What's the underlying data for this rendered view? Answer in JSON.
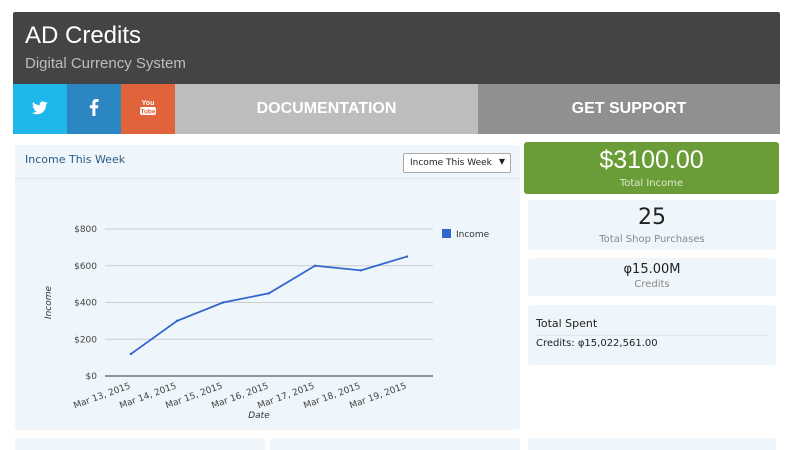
{
  "header": {
    "title": "AD Credits",
    "subtitle": "Digital Currency System"
  },
  "nav": {
    "documentation": "DOCUMENTATION",
    "support": "GET SUPPORT"
  },
  "panel": {
    "title": "Income This Week",
    "select_value": "Income This Week"
  },
  "summary": {
    "total_income_value": "$3100.00",
    "total_income_label": "Total Income",
    "shop_purchases_value": "25",
    "shop_purchases_label": "Total Shop Purchases",
    "credits_value": "φ15.00M",
    "credits_label": "Credits",
    "total_spent_title": "Total Spent",
    "total_spent_value": "Credits: φ15,022,561.00"
  },
  "colors": {
    "header_bg": "#444444",
    "twitter": "#1fb6ea",
    "facebook": "#2c86c2",
    "youtube": "#e0633c",
    "total_income_card": "#6a9c37",
    "series_line": "#3366cc"
  },
  "icons": [
    "twitter-icon",
    "facebook-icon",
    "youtube-icon"
  ],
  "chart_data": {
    "type": "line",
    "categories": [
      "Mar 13, 2015",
      "Mar 14, 2015",
      "Mar 15, 2015",
      "Mar 16, 2015",
      "Mar 17, 2015",
      "Mar 18, 2015",
      "Mar 19, 2015"
    ],
    "series": [
      {
        "name": "Income",
        "values": [
          120,
          300,
          400,
          450,
          600,
          575,
          650
        ],
        "color": "#3366cc"
      }
    ],
    "xlabel": "Date",
    "ylabel": "Income",
    "ylim": [
      0,
      800
    ],
    "yticks": [
      0,
      200,
      400,
      600,
      800
    ],
    "ytick_labels": [
      "$0",
      "$200",
      "$400",
      "$600",
      "$800"
    ],
    "grid": true,
    "legend": "right"
  }
}
